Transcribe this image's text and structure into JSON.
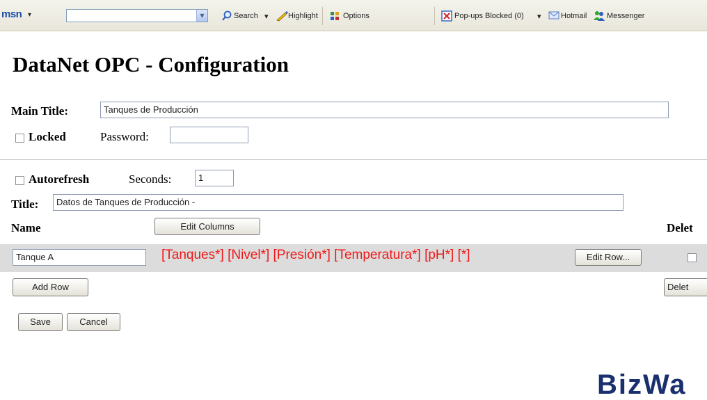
{
  "toolbar": {
    "logo": "msn",
    "search_label": "Search",
    "highlight_label": "Highlight",
    "options_label": "Options",
    "popups_label": "Pop-ups Blocked (0)",
    "hotmail_label": "Hotmail",
    "messenger_label": "Messenger"
  },
  "page": {
    "title": "DataNet OPC - Configuration"
  },
  "main_title": {
    "label": "Main Title:",
    "value": "Tanques de Producción"
  },
  "locked": {
    "label": "Locked",
    "checked": false,
    "password_label": "Password:",
    "password_value": ""
  },
  "autorefresh": {
    "label": "Autorefresh",
    "checked": false,
    "seconds_label": "Seconds:",
    "seconds_value": "1"
  },
  "table_title": {
    "label": "Title:",
    "value": "Datos de Tanques de Producción -"
  },
  "grid": {
    "name_header": "Name",
    "edit_columns_label": "Edit Columns",
    "delete_header": "Delet",
    "rows": [
      {
        "name": "Tanque A",
        "tags": "[Tanques*] [Nivel*] [Presión*] [Temperatura*] [pH*] [*]",
        "edit_row_label": "Edit Row...",
        "delete_checked": false
      }
    ],
    "add_row_label": "Add Row",
    "delete_button_label": "Delet"
  },
  "actions": {
    "save_label": "Save",
    "cancel_label": "Cancel"
  },
  "footer": {
    "logo_text": "BizWa"
  },
  "colors": {
    "tag_text": "#f01818",
    "row_band": "#dcdcdc",
    "logo": "#1a2f6d"
  }
}
